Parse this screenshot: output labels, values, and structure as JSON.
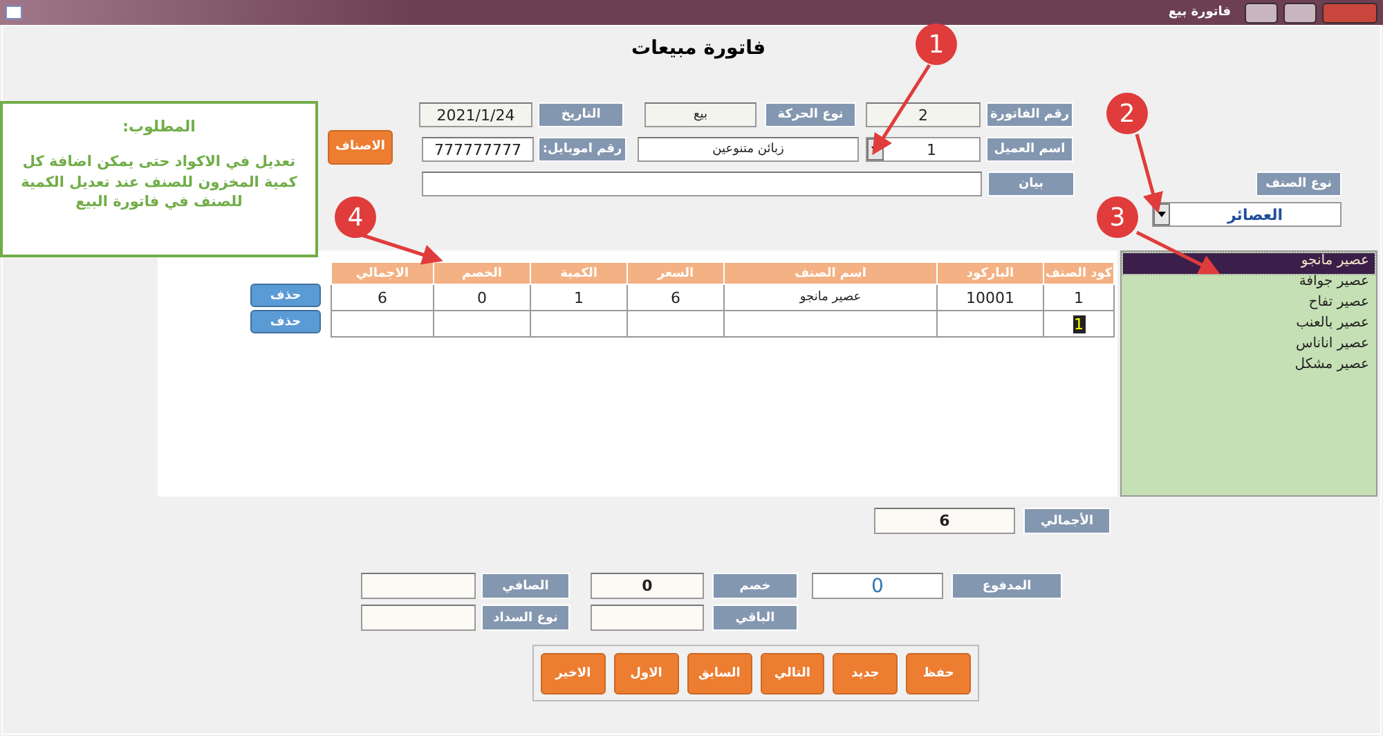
{
  "window": {
    "title": "فاتورة بيع"
  },
  "form_title": "فاتورة مبيعات",
  "invoice": {
    "number_label": "رقم الفاتورة",
    "number": "2",
    "movement_label": "نوع الحركة",
    "movement": "بيع",
    "date_label": "التاريخ",
    "date": "2021/1/24",
    "customer_label": "اسم العميل",
    "customer_code": "1",
    "customer_name": "زبائن متنوعين",
    "mobile_label": "رقم اموبايل:",
    "mobile": "777777777",
    "note_label": "بيان"
  },
  "items_button": "الاصناف",
  "category": {
    "label": "نوع الصنف",
    "value": "العصائر"
  },
  "products": [
    {
      "name": "عصير مانجو",
      "selected": true
    },
    {
      "name": "عصير جوافة",
      "selected": false
    },
    {
      "name": "عصير تفاح",
      "selected": false
    },
    {
      "name": "عصير بالعنب",
      "selected": false
    },
    {
      "name": "عصير اناناس",
      "selected": false
    },
    {
      "name": "عصير مشكل",
      "selected": false
    }
  ],
  "table": {
    "columns": [
      "كود الصنف",
      "الباركود",
      "اسم الصنف",
      "السعر",
      "الكمية",
      "الخصم",
      "الاجمالي"
    ],
    "rows": [
      {
        "cells": [
          "1",
          "10001",
          "عصير مانجو",
          "6",
          "1",
          "0",
          "6"
        ],
        "delete": "حذف"
      }
    ],
    "new_row": {
      "code": "1",
      "delete": "حذف"
    }
  },
  "totals": {
    "total_label": "الأجمالي",
    "total": "6",
    "paid_label": "المدفوع",
    "paid": "0",
    "discount_label": "خصم",
    "discount": "0",
    "remaining_label": "الباقي",
    "net_label": "الصافي",
    "payment_type_label": "نوع السداد"
  },
  "nav_buttons": [
    "حفظ",
    "جديد",
    "التالي",
    "السابق",
    "الاول",
    "الاخير"
  ],
  "note": {
    "heading": "المطلوب:",
    "body": "تعديل في الاكواد حتى يمكن اضافة كل كمية المخزون للصنف عند تعديل الكمية للصنف  في فاتورة البيع"
  },
  "callouts": [
    "1",
    "2",
    "3",
    "4"
  ]
}
